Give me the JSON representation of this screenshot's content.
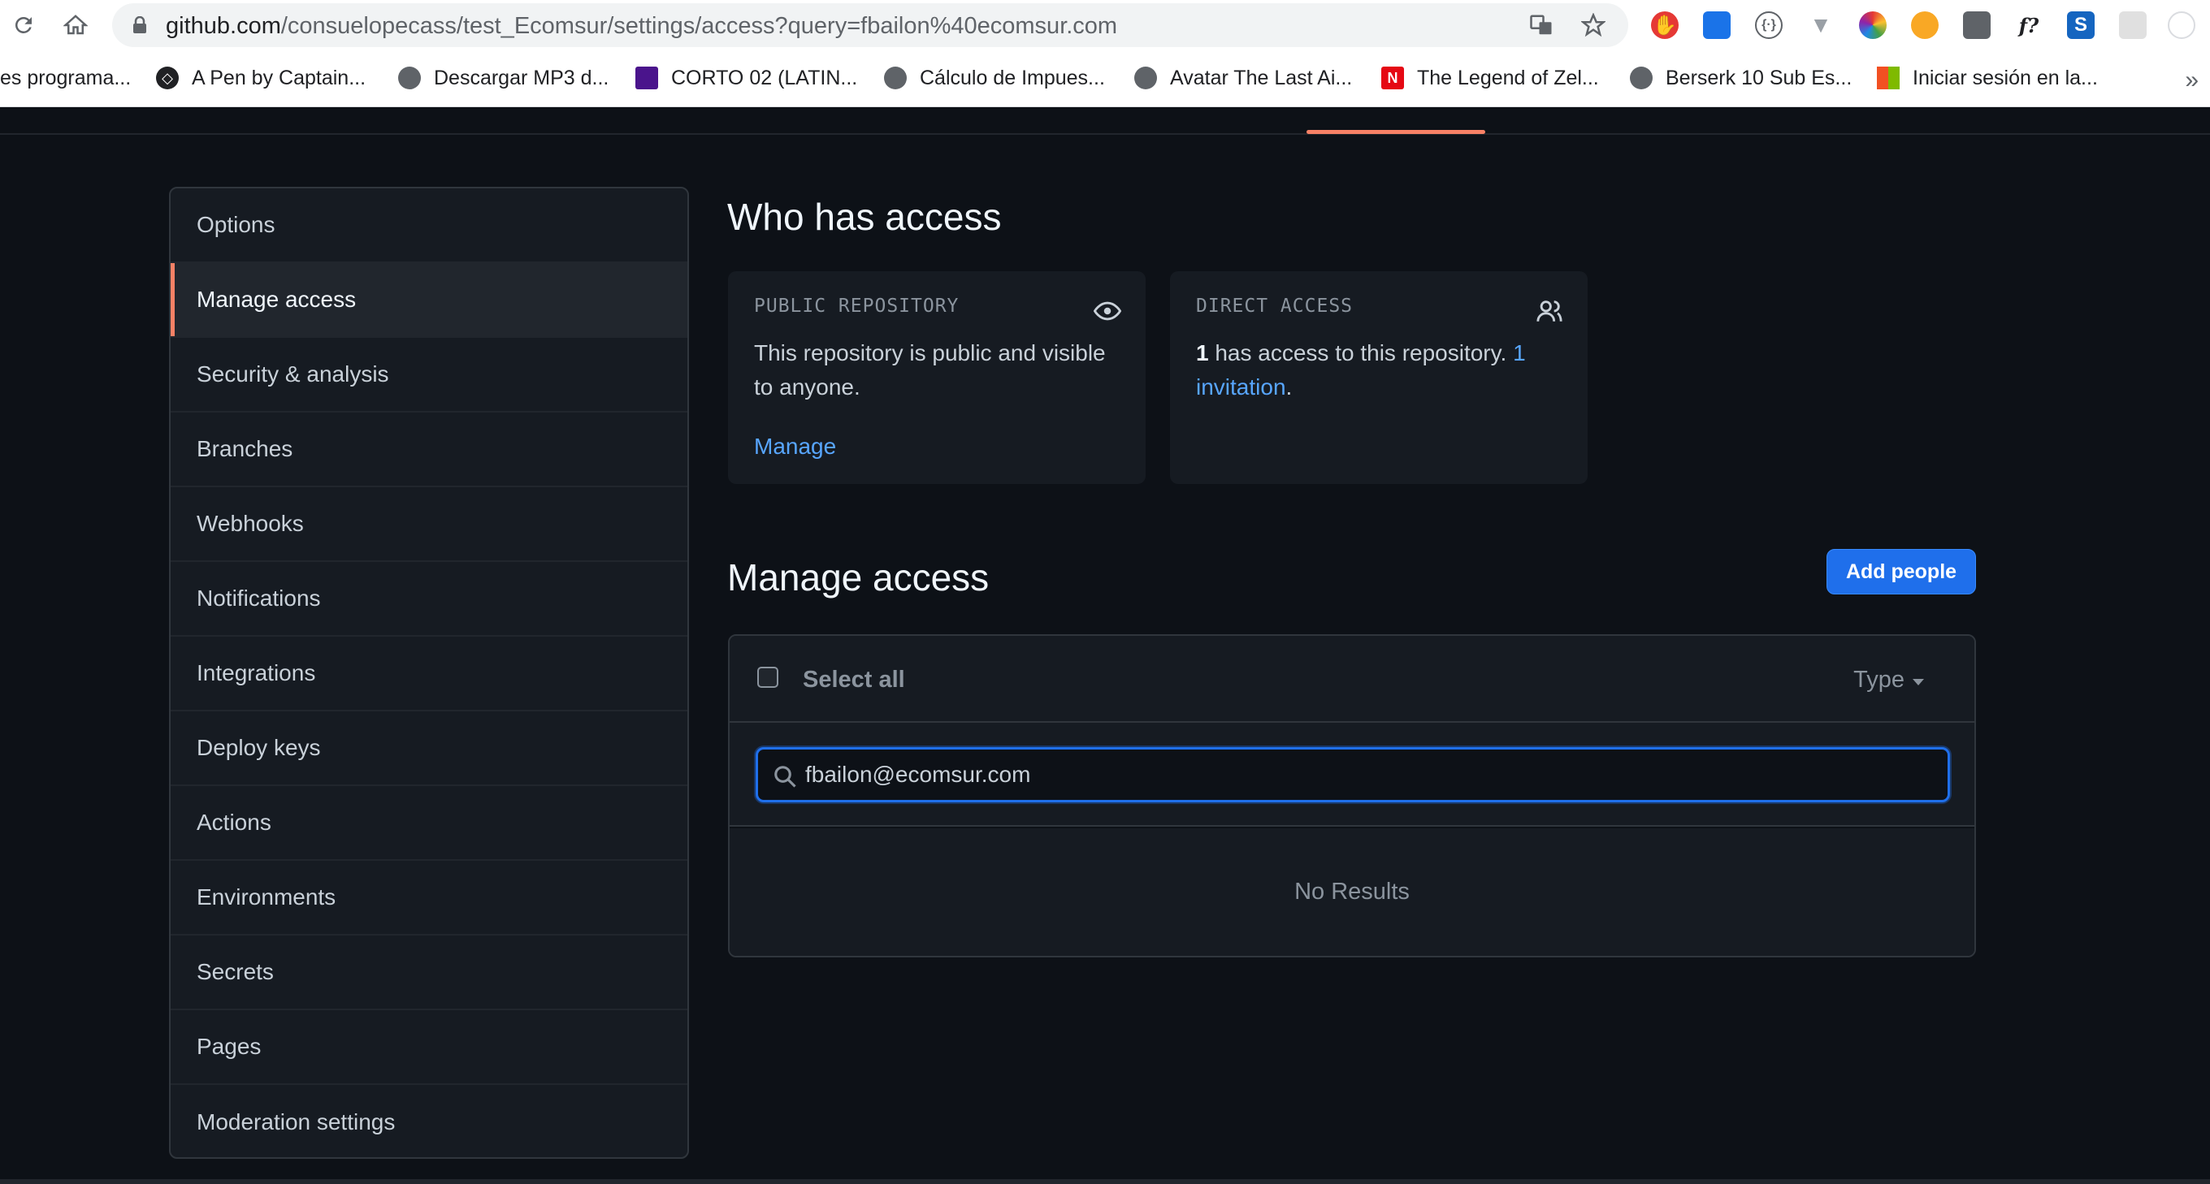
{
  "browser": {
    "url_host": "github.com",
    "url_path": "/consuelopecass/test_Ecomsur/settings/access?query=fbailon%40ecomsur.com",
    "bookmarks": [
      {
        "label": "es programa..."
      },
      {
        "label": "A Pen by Captain..."
      },
      {
        "label": "Descargar MP3 d..."
      },
      {
        "label": "CORTO 02 (LATIN..."
      },
      {
        "label": "Cálculo de Impues..."
      },
      {
        "label": "Avatar The Last Ai..."
      },
      {
        "label": "The Legend of Zel..."
      },
      {
        "label": "Berserk 10 Sub Es..."
      },
      {
        "label": "Iniciar sesión en la..."
      }
    ],
    "more_bookmarks": "»"
  },
  "sidebar": {
    "items": [
      {
        "label": "Options"
      },
      {
        "label": "Manage access"
      },
      {
        "label": "Security & analysis"
      },
      {
        "label": "Branches"
      },
      {
        "label": "Webhooks"
      },
      {
        "label": "Notifications"
      },
      {
        "label": "Integrations"
      },
      {
        "label": "Deploy keys"
      },
      {
        "label": "Actions"
      },
      {
        "label": "Environments"
      },
      {
        "label": "Secrets"
      },
      {
        "label": "Pages"
      },
      {
        "label": "Moderation settings"
      }
    ],
    "active_index": 1
  },
  "who_has_access": {
    "title": "Who has access",
    "public_card": {
      "header": "PUBLIC REPOSITORY",
      "body": "This repository is public and visible to anyone.",
      "link": "Manage"
    },
    "direct_card": {
      "header": "DIRECT ACCESS",
      "count": "1",
      "body": " has access to this repository. ",
      "link": "1 invitation",
      "suffix": "."
    }
  },
  "manage_access": {
    "title": "Manage access",
    "add_button": "Add people",
    "select_all": "Select all",
    "type_filter": "Type",
    "search_value": "fbailon@ecomsur.com",
    "empty_state": "No Results"
  },
  "colors": {
    "accent": "#f78166",
    "link": "#58a6ff",
    "primary_button": "#1f6feb",
    "background": "#0d1117"
  }
}
